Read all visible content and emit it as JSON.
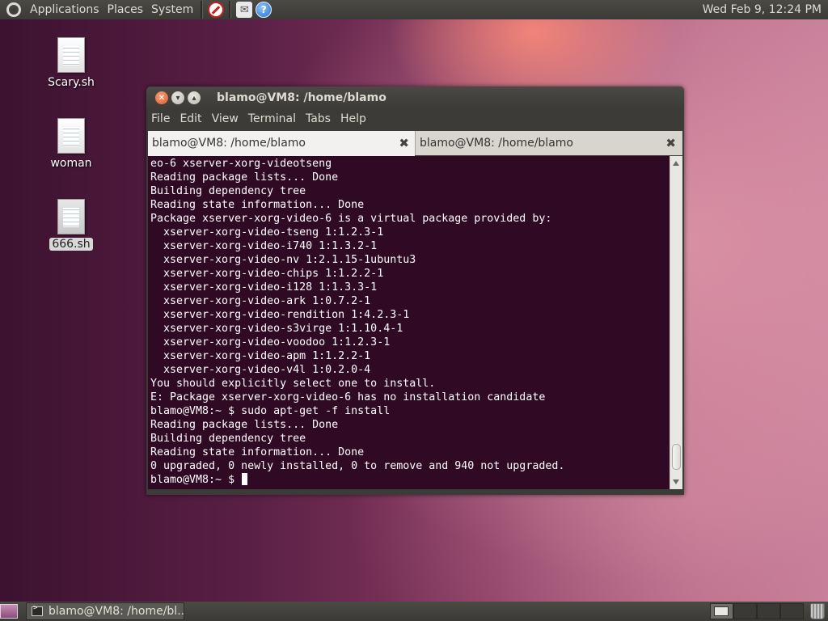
{
  "top_panel": {
    "menus": [
      "Applications",
      "Places",
      "System"
    ],
    "clock": "Wed Feb  9, 12:24 PM"
  },
  "desktop": {
    "icons": [
      {
        "label": "Scary.sh",
        "selected": false
      },
      {
        "label": "woman",
        "selected": false
      },
      {
        "label": "666.sh",
        "selected": true
      }
    ]
  },
  "window": {
    "title": "blamo@VM8: /home/blamo",
    "menus": [
      "File",
      "Edit",
      "View",
      "Terminal",
      "Tabs",
      "Help"
    ],
    "tabs": [
      {
        "label": "blamo@VM8: /home/blamo",
        "active": true
      },
      {
        "label": "blamo@VM8: /home/blamo",
        "active": false
      }
    ],
    "terminal_lines": [
      "eo-6 xserver-xorg-videotseng",
      "Reading package lists... Done",
      "Building dependency tree",
      "Reading state information... Done",
      "Package xserver-xorg-video-6 is a virtual package provided by:",
      "  xserver-xorg-video-tseng 1:1.2.3-1",
      "  xserver-xorg-video-i740 1:1.3.2-1",
      "  xserver-xorg-video-nv 1:2.1.15-1ubuntu3",
      "  xserver-xorg-video-chips 1:1.2.2-1",
      "  xserver-xorg-video-i128 1:1.3.3-1",
      "  xserver-xorg-video-ark 1:0.7.2-1",
      "  xserver-xorg-video-rendition 1:4.2.3-1",
      "  xserver-xorg-video-s3virge 1:1.10.4-1",
      "  xserver-xorg-video-voodoo 1:1.2.3-1",
      "  xserver-xorg-video-apm 1:1.2.2-1",
      "  xserver-xorg-video-v4l 1:0.2.0-4",
      "You should explicitly select one to install.",
      "E: Package xserver-xorg-video-6 has no installation candidate",
      "blamo@VM8:~ $ sudo apt-get -f install",
      "Reading package lists... Done",
      "Building dependency tree",
      "Reading state information... Done",
      "0 upgraded, 0 newly installed, 0 to remove and 940 not upgraded."
    ],
    "prompt": "blamo@VM8:~ $ "
  },
  "bottom_panel": {
    "task_label": "blamo@VM8: /home/bl..."
  },
  "colors": {
    "terminal_bg": "#300a24",
    "terminal_fg": "#ffffff",
    "panel_bg": "#3c3b37"
  }
}
